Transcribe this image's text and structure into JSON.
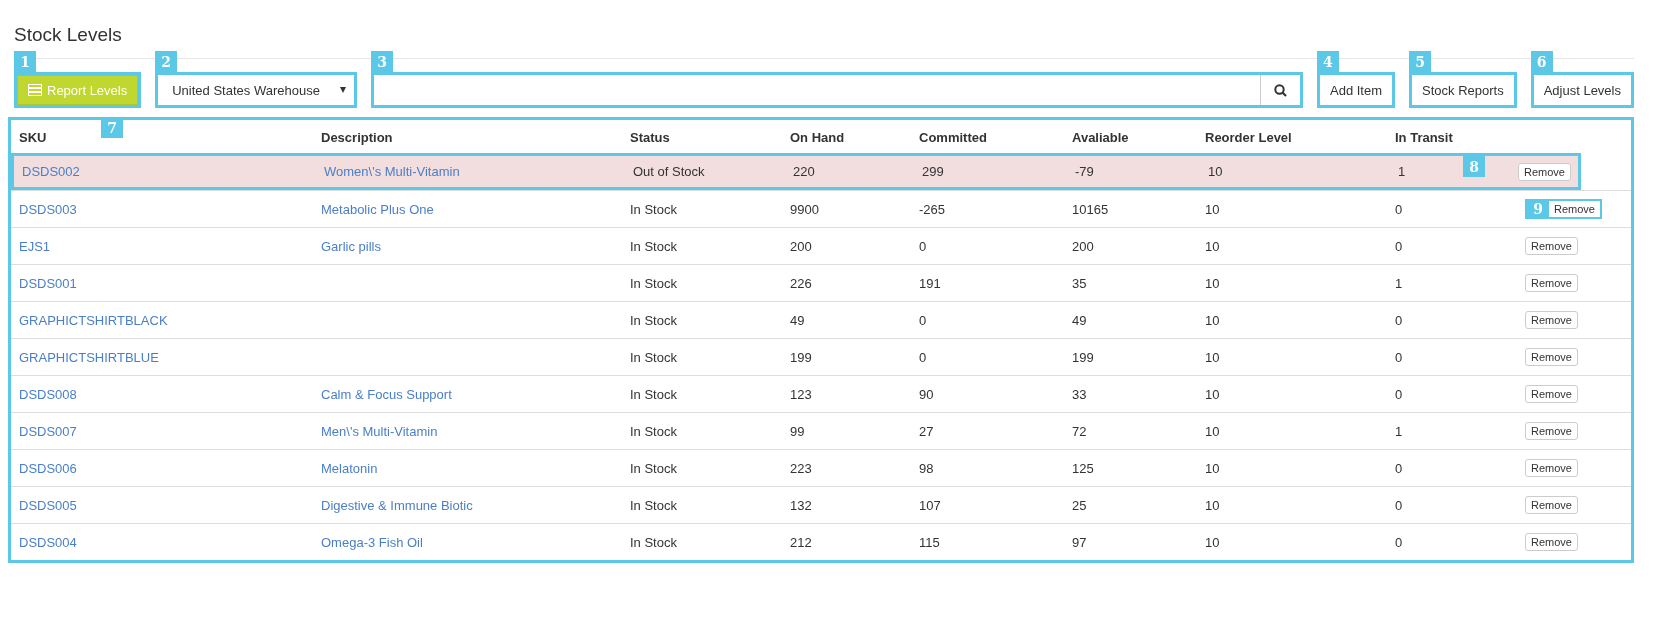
{
  "page_title": "Stock Levels",
  "toolbar": {
    "report_button": {
      "label": "Report Levels",
      "callout": "1"
    },
    "warehouse_select": {
      "value": "United States Warehouse",
      "callout": "2"
    },
    "search": {
      "callout": "3"
    },
    "buttons": [
      {
        "label": "Add Item",
        "callout": "4"
      },
      {
        "label": "Stock Reports",
        "callout": "5"
      },
      {
        "label": "Adjust Levels",
        "callout": "6"
      }
    ]
  },
  "table": {
    "callout": "7",
    "columns": [
      "SKU",
      "Description",
      "Status",
      "On Hand",
      "Committed",
      "Avaliable",
      "Reorder Level",
      "In Transit"
    ],
    "rows": [
      {
        "sku": "DSDS002",
        "description": "Women\\'s Multi-Vitamin",
        "status": "Out of Stock",
        "on_hand": "220",
        "committed": "299",
        "available": "-79",
        "reorder_level": "10",
        "in_transit": "1",
        "highlighted": true,
        "callout": "8",
        "remove": {
          "label": "Remove"
        }
      },
      {
        "sku": "DSDS003",
        "description": "Metabolic Plus One",
        "status": "In Stock",
        "on_hand": "9900",
        "committed": "-265",
        "available": "10165",
        "reorder_level": "10",
        "in_transit": "0",
        "highlighted": false,
        "remove": {
          "label": "Remove",
          "callout": "9"
        }
      },
      {
        "sku": "EJS1",
        "description": "Garlic pills",
        "status": "In Stock",
        "on_hand": "200",
        "committed": "0",
        "available": "200",
        "reorder_level": "10",
        "in_transit": "0",
        "highlighted": false,
        "remove": {
          "label": "Remove"
        }
      },
      {
        "sku": "DSDS001",
        "status": "In Stock",
        "on_hand": "226",
        "committed": "191",
        "available": "35",
        "reorder_level": "10",
        "in_transit": "1",
        "highlighted": false,
        "remove": {
          "label": "Remove"
        }
      },
      {
        "sku": "GRAPHICTSHIRTBLACK",
        "status": "In Stock",
        "on_hand": "49",
        "committed": "0",
        "available": "49",
        "reorder_level": "10",
        "in_transit": "0",
        "highlighted": false,
        "remove": {
          "label": "Remove"
        }
      },
      {
        "sku": "GRAPHICTSHIRTBLUE",
        "status": "In Stock",
        "on_hand": "199",
        "committed": "0",
        "available": "199",
        "reorder_level": "10",
        "in_transit": "0",
        "highlighted": false,
        "remove": {
          "label": "Remove"
        }
      },
      {
        "sku": "DSDS008",
        "description": "Calm & Focus Support",
        "status": "In Stock",
        "on_hand": "123",
        "committed": "90",
        "available": "33",
        "reorder_level": "10",
        "in_transit": "0",
        "highlighted": false,
        "remove": {
          "label": "Remove"
        }
      },
      {
        "sku": "DSDS007",
        "description": "Men\\'s Multi-Vitamin",
        "status": "In Stock",
        "on_hand": "99",
        "committed": "27",
        "available": "72",
        "reorder_level": "10",
        "in_transit": "1",
        "highlighted": false,
        "remove": {
          "label": "Remove"
        }
      },
      {
        "sku": "DSDS006",
        "description": "Melatonin",
        "status": "In Stock",
        "on_hand": "223",
        "committed": "98",
        "available": "125",
        "reorder_level": "10",
        "in_transit": "0",
        "highlighted": false,
        "remove": {
          "label": "Remove"
        }
      },
      {
        "sku": "DSDS005",
        "description": "Digestive & Immune Biotic",
        "status": "In Stock",
        "on_hand": "132",
        "committed": "107",
        "available": "25",
        "reorder_level": "10",
        "in_transit": "0",
        "highlighted": false,
        "remove": {
          "label": "Remove"
        }
      },
      {
        "sku": "DSDS004",
        "description": "Omega-3 Fish Oil",
        "status": "In Stock",
        "on_hand": "212",
        "committed": "115",
        "available": "97",
        "reorder_level": "10",
        "in_transit": "0",
        "highlighted": false,
        "remove": {
          "label": "Remove"
        }
      }
    ]
  }
}
